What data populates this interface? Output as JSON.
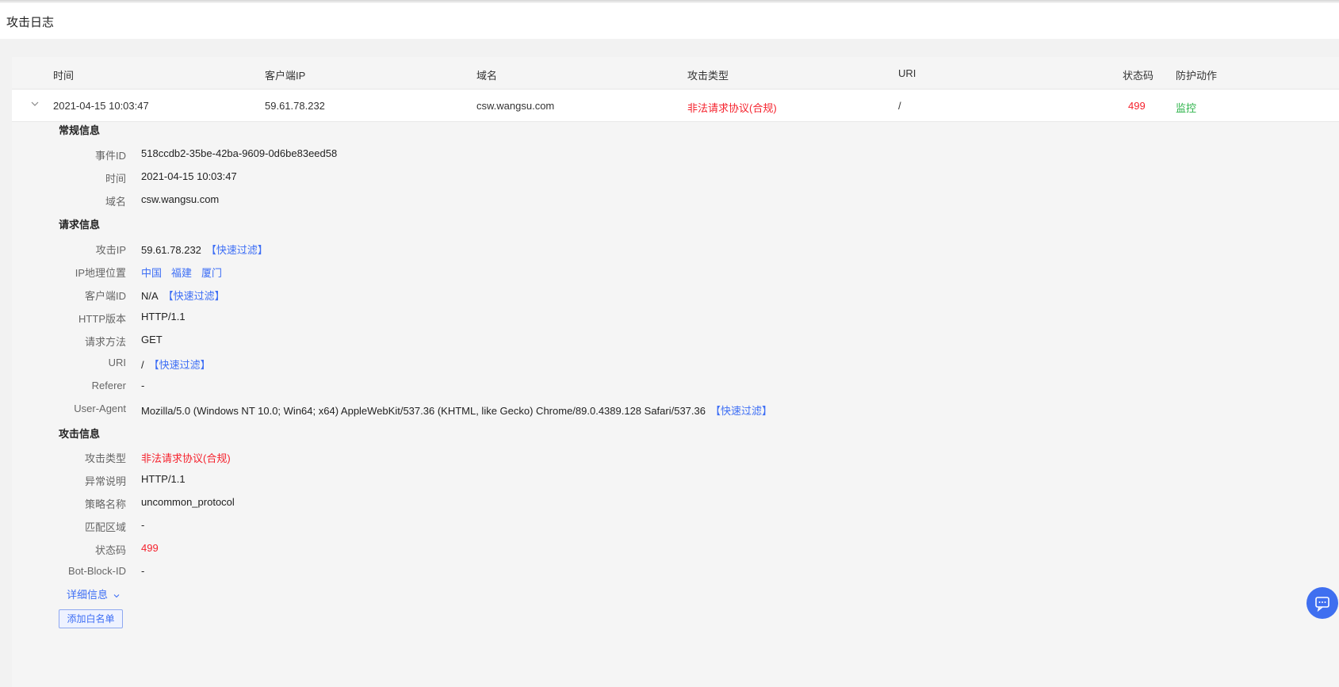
{
  "page": {
    "title": "攻击日志"
  },
  "table": {
    "headers": {
      "time": "时间",
      "client_ip": "客户端IP",
      "domain": "域名",
      "attack_type": "攻击类型",
      "uri": "URI",
      "status": "状态码",
      "action": "防护动作"
    },
    "row": {
      "time": "2021-04-15 10:03:47",
      "client_ip": "59.61.78.232",
      "domain": "csw.wangsu.com",
      "attack_type": "非法请求协议(合规)",
      "uri": "/",
      "status": "499",
      "action": "监控"
    }
  },
  "detail": {
    "general": {
      "title": "常规信息",
      "event_id_label": "事件ID",
      "event_id": "518ccdb2-35be-42ba-9609-0d6be83eed58",
      "time_label": "时间",
      "time": "2021-04-15 10:03:47",
      "domain_label": "域名",
      "domain": "csw.wangsu.com"
    },
    "request": {
      "title": "请求信息",
      "attack_ip_label": "攻击IP",
      "attack_ip": "59.61.78.232",
      "geo_label": "IP地理位置",
      "geo_country": "中国",
      "geo_province": "福建",
      "geo_city": "厦门",
      "client_id_label": "客户端ID",
      "client_id": "N/A",
      "http_version_label": "HTTP版本",
      "http_version": "HTTP/1.1",
      "method_label": "请求方法",
      "method": "GET",
      "uri_label": "URI",
      "uri": "/",
      "referer_label": "Referer",
      "referer": "-",
      "ua_label": "User-Agent",
      "ua": "Mozilla/5.0 (Windows NT 10.0; Win64; x64) AppleWebKit/537.36 (KHTML, like Gecko) Chrome/89.0.4389.128 Safari/537.36"
    },
    "attack": {
      "title": "攻击信息",
      "type_label": "攻击类型",
      "type": "非法请求协议(合规)",
      "desc_label": "异常说明",
      "desc": "HTTP/1.1",
      "policy_label": "策略名称",
      "policy": "uncommon_protocol",
      "zone_label": "匹配区域",
      "zone": "-",
      "status_label": "状态码",
      "status": "499",
      "bot_label": "Bot-Block-ID",
      "bot": "-"
    },
    "quick_filter": "【快速过滤】",
    "more_label": "详细信息",
    "whitelist_button": "添加白名单"
  },
  "colors": {
    "accent": "#3d6ef5",
    "danger": "#f5222d",
    "success": "#2db34a"
  },
  "icons": {
    "expand": "chevron-down-icon",
    "chat": "chat-icon"
  }
}
